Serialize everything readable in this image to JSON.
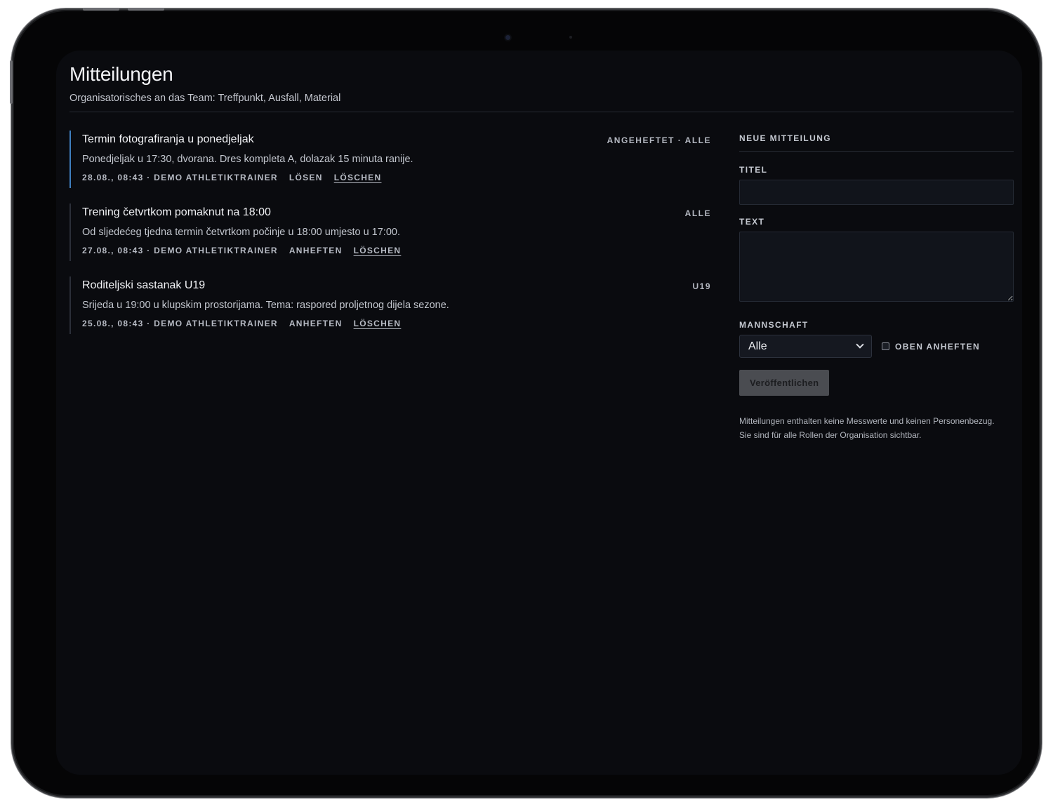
{
  "header": {
    "title": "Mitteilungen",
    "subtitle": "Organisatorisches an das Team: Treffpunkt, Ausfall, Material"
  },
  "announcements": [
    {
      "title": "Termin fotografiranja u ponedjeljak",
      "body": "Ponedjeljak u 17:30, dvorana. Dres kompleta A, dolazak 15 minuta ranije.",
      "meta": "28.08., 08:43 · DEMO ATHLETIKTRAINER",
      "pin_action": "LÖSEN",
      "delete_action": "LÖSCHEN",
      "tag": "ANGEHEFTET · ALLE"
    },
    {
      "title": "Trening četvrtkom pomaknut na 18:00",
      "body": "Od sljedećeg tjedna termin četvrtkom počinje u 18:00 umjesto u 17:00.",
      "meta": "27.08., 08:43 · DEMO ATHLETIKTRAINER",
      "pin_action": "ANHEFTEN",
      "delete_action": "LÖSCHEN",
      "tag": "ALLE"
    },
    {
      "title": "Roditeljski sastanak U19",
      "body": "Srijeda u 19:00 u klupskim prostorijama. Tema: raspored proljetnog dijela sezone.",
      "meta": "25.08., 08:43 · DEMO ATHLETIKTRAINER",
      "pin_action": "ANHEFTEN",
      "delete_action": "LÖSCHEN",
      "tag": "U19"
    }
  ],
  "form": {
    "heading": "NEUE MITTEILUNG",
    "title_label": "TITEL",
    "title_value": "",
    "text_label": "TEXT",
    "text_value": "",
    "team_label": "MANNSCHAFT",
    "team_selected": "Alle",
    "pin_label": "OBEN ANHEFTEN",
    "pin_checked": false,
    "publish_label": "Veröffentlichen",
    "note_line1": "Mitteilungen enthalten keine Messwerte und keinen Personenbezug.",
    "note_line2": "Sie sind für alle Rollen der Organisation sichtbar."
  },
  "icons": {
    "dropdown": "chevron-down-icon"
  },
  "colors": {
    "background": "#0a0b0f",
    "pinned_accent": "#3f7fbf",
    "border": "#2b2f39",
    "button_disabled": "#4a4c51"
  }
}
